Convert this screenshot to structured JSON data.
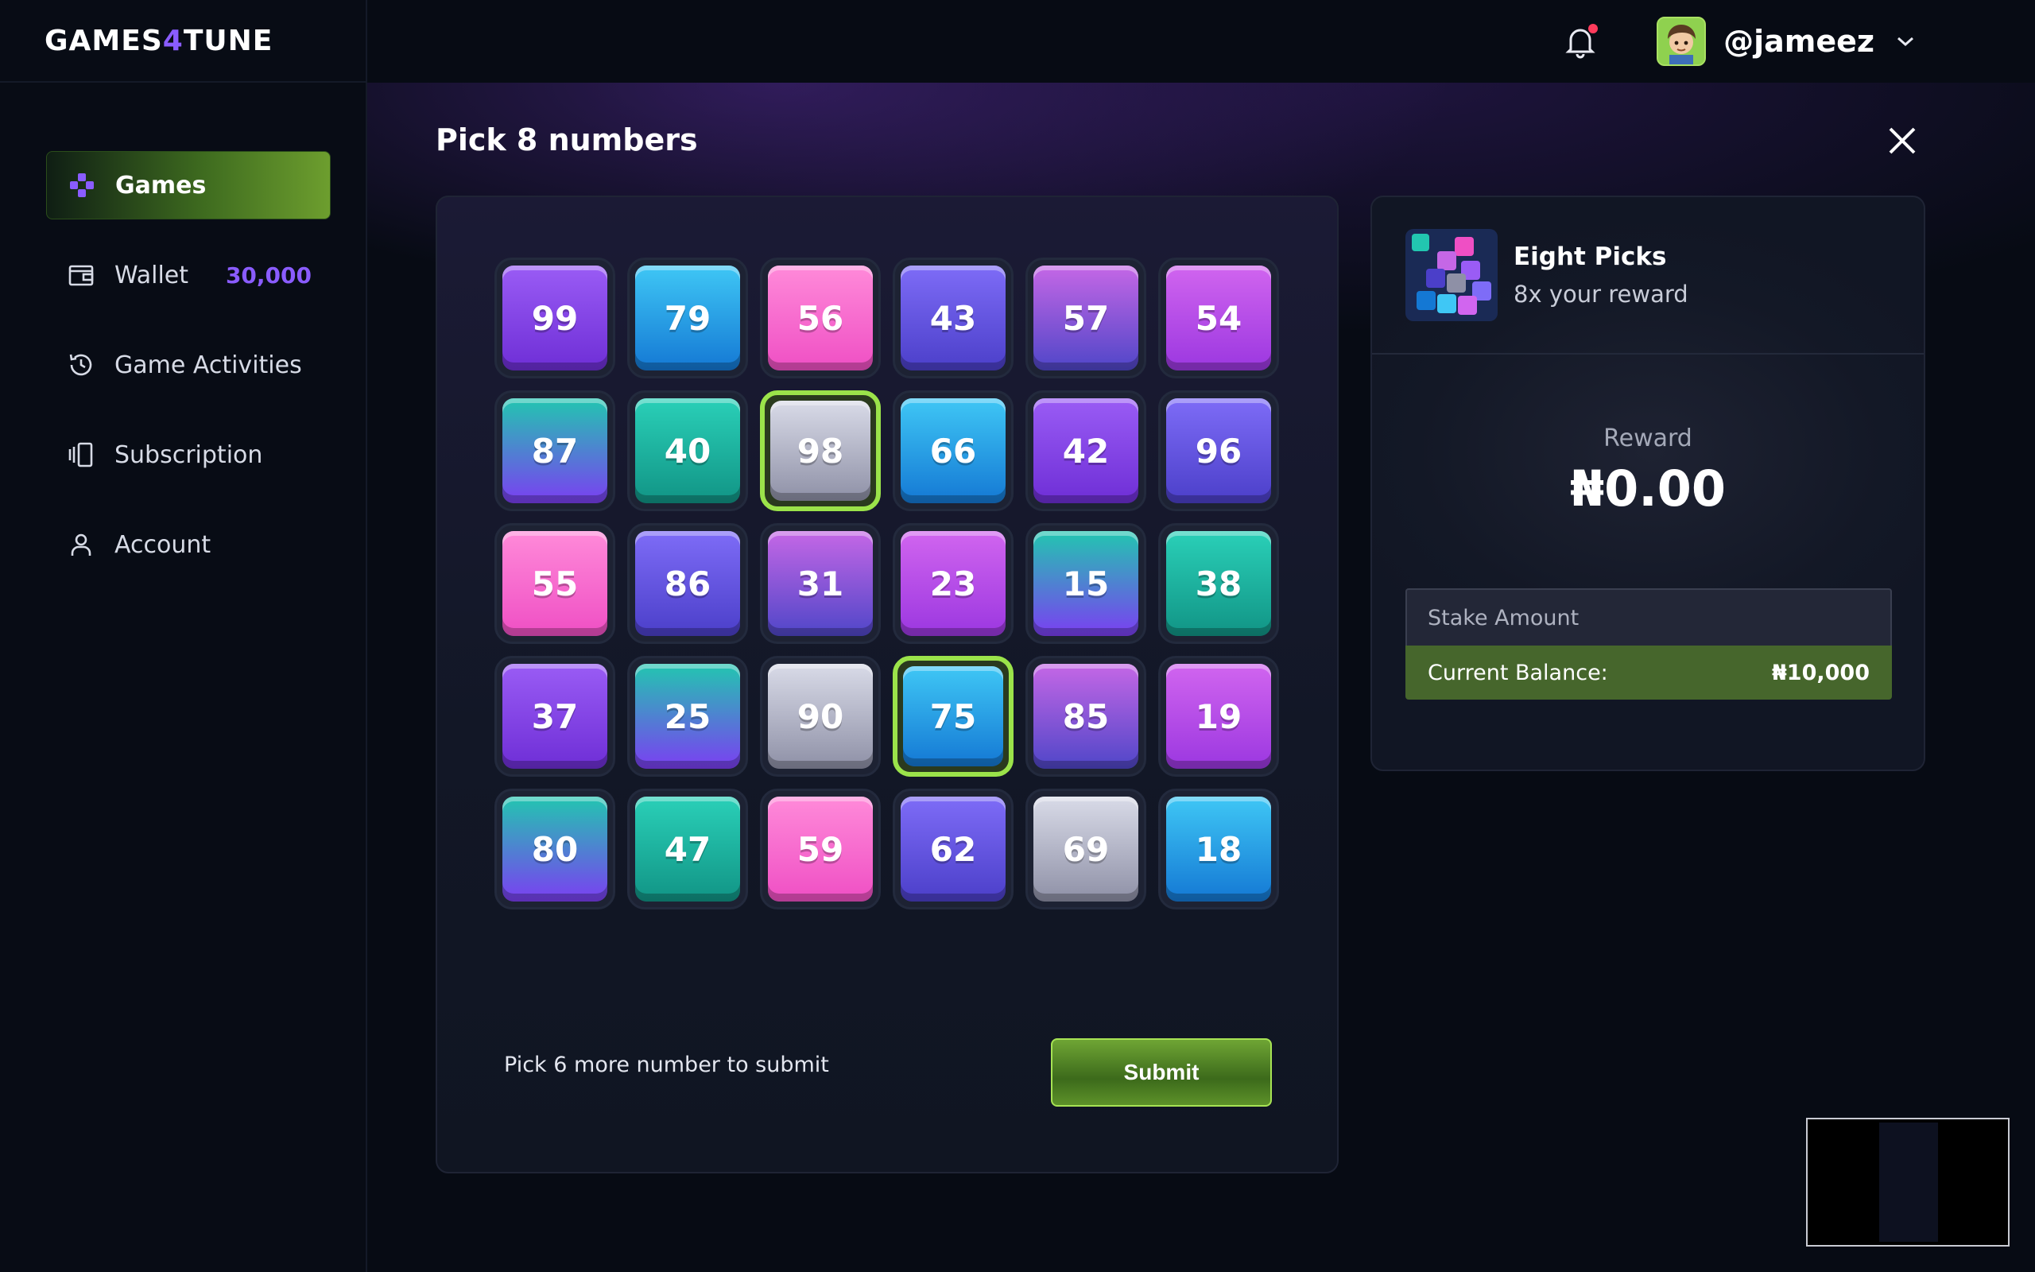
{
  "app": {
    "logo_main": "GAMES",
    "logo_accent": "4",
    "logo_tail": "TUNE"
  },
  "sidebar": {
    "items": [
      {
        "label": "Games",
        "icon": "gamepad-icon",
        "active": true
      },
      {
        "label": "Wallet",
        "icon": "wallet-icon",
        "badge": "30,000"
      },
      {
        "label": "Game Activities",
        "icon": "history-icon"
      },
      {
        "label": "Subscription",
        "icon": "subscription-icon"
      },
      {
        "label": "Account",
        "icon": "user-icon"
      }
    ]
  },
  "header": {
    "username": "@jameez",
    "has_notification": true
  },
  "board": {
    "title": "Pick 8 numbers",
    "numbers": [
      {
        "n": "99",
        "c": "violet"
      },
      {
        "n": "79",
        "c": "blue"
      },
      {
        "n": "56",
        "c": "pink"
      },
      {
        "n": "43",
        "c": "indigo"
      },
      {
        "n": "57",
        "c": "plum"
      },
      {
        "n": "54",
        "c": "magenta"
      },
      {
        "n": "87",
        "c": "tealv"
      },
      {
        "n": "40",
        "c": "teal"
      },
      {
        "n": "98",
        "c": "silver",
        "selected": true
      },
      {
        "n": "66",
        "c": "blue"
      },
      {
        "n": "42",
        "c": "violet"
      },
      {
        "n": "96",
        "c": "indigo"
      },
      {
        "n": "55",
        "c": "pink"
      },
      {
        "n": "86",
        "c": "indigo"
      },
      {
        "n": "31",
        "c": "plum"
      },
      {
        "n": "23",
        "c": "magenta"
      },
      {
        "n": "15",
        "c": "tealv"
      },
      {
        "n": "38",
        "c": "teal"
      },
      {
        "n": "37",
        "c": "violet"
      },
      {
        "n": "25",
        "c": "tealv"
      },
      {
        "n": "90",
        "c": "silver"
      },
      {
        "n": "75",
        "c": "blue",
        "selected": true
      },
      {
        "n": "85",
        "c": "plum"
      },
      {
        "n": "19",
        "c": "magenta"
      },
      {
        "n": "80",
        "c": "tealv"
      },
      {
        "n": "47",
        "c": "teal"
      },
      {
        "n": "59",
        "c": "pink"
      },
      {
        "n": "62",
        "c": "indigo"
      },
      {
        "n": "69",
        "c": "silver"
      },
      {
        "n": "18",
        "c": "blue"
      }
    ],
    "hint": "Pick 6 more number to submit",
    "submit_label": "Submit"
  },
  "game": {
    "name": "Eight Picks",
    "subtitle": "8x your reward",
    "reward_label": "Reward",
    "reward_value": "₦0.00",
    "stake_placeholder": "Stake Amount",
    "balance_label": "Current Balance:",
    "balance_value": "₦10,000"
  },
  "colors": {
    "accent_purple": "#8a5cff",
    "accent_green": "#9be34a",
    "background": "#070b14"
  }
}
